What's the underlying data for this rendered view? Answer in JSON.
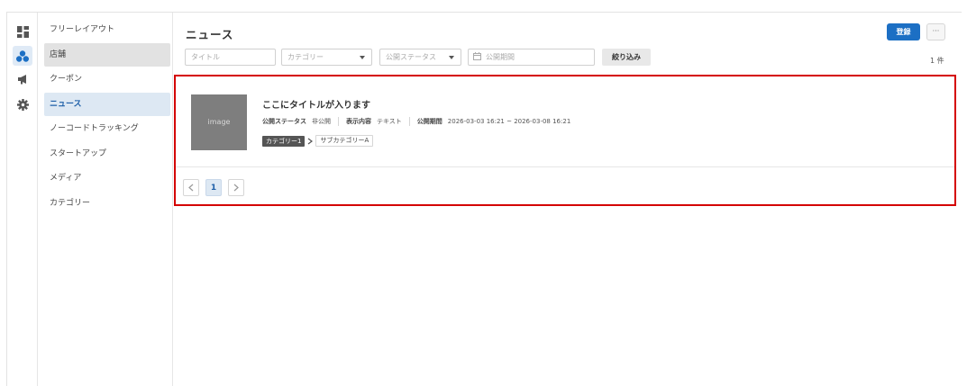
{
  "rail": {
    "icons": [
      "dashboard-icon",
      "group-icon",
      "megaphone-icon",
      "gear-icon"
    ]
  },
  "sidebar": {
    "items": [
      {
        "label": "フリーレイアウト"
      },
      {
        "label": "店舗"
      },
      {
        "label": "クーポン"
      },
      {
        "label": "ニュース"
      },
      {
        "label": "ノーコードトラッキング"
      },
      {
        "label": "スタートアップ"
      },
      {
        "label": "メディア"
      },
      {
        "label": "カテゴリー"
      }
    ]
  },
  "header": {
    "title": "ニュース",
    "register_label": "登録",
    "more_label": "···"
  },
  "filters": {
    "title_placeholder": "タイトル",
    "category_placeholder": "カテゴリー",
    "status_placeholder": "公開ステータス",
    "period_placeholder": "公開期間",
    "filter_button": "絞り込み",
    "count": "1 件"
  },
  "news": {
    "thumb_text": "image",
    "title": "ここにタイトルが入ります",
    "status_key": "公開ステータス",
    "status_value": "非公開",
    "display_key": "表示内容",
    "display_value": "テキスト",
    "period_key": "公開期間",
    "period_value": "2026-03-03 16:21 ~ 2026-03-08 16:21",
    "category": "カテゴリー1",
    "subcategory": "サブカテゴリーA"
  },
  "pagination": {
    "current": "1"
  },
  "colors": {
    "primary": "#1c6fc4",
    "highlight": "#d40000",
    "active_bg": "#dde8f3"
  }
}
